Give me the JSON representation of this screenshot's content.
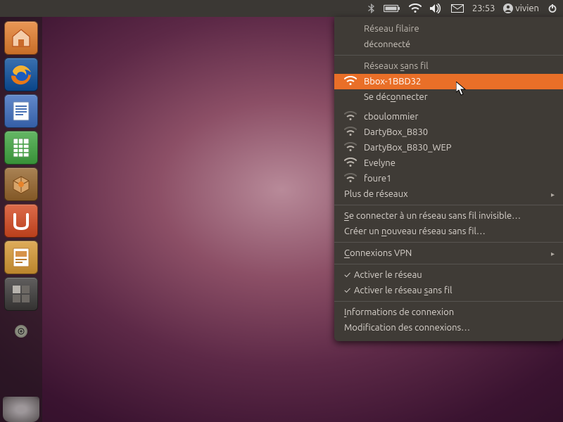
{
  "panel": {
    "time": "23:53",
    "user": "vivien"
  },
  "launcher": {
    "items": [
      {
        "id": "home",
        "name": "files-home"
      },
      {
        "id": "firefox",
        "name": "firefox"
      },
      {
        "id": "writer",
        "name": "libreoffice-writer"
      },
      {
        "id": "calc",
        "name": "libreoffice-calc"
      },
      {
        "id": "software",
        "name": "software-center"
      },
      {
        "id": "ubuntuone",
        "name": "ubuntu-one"
      },
      {
        "id": "impress",
        "name": "libreoffice-impress"
      },
      {
        "id": "workspace",
        "name": "workspace-switcher"
      }
    ]
  },
  "network_menu": {
    "wired_header": "Réseau filaire",
    "wired_status": "déconnecté",
    "wireless_header": "Réseaux sans fil",
    "selected_network": "Bbox-1BBD32",
    "disconnect": "Se déconnecter",
    "other_networks": [
      "cboulommier",
      "DartyBox_B830",
      "DartyBox_B830_WEP",
      "Evelyne",
      "foure1"
    ],
    "more_networks": "Plus de réseaux",
    "connect_hidden": "Se connecter à un réseau sans fil invisible…",
    "create_new": "Créer un nouveau réseau sans fil…",
    "vpn": "Connexions VPN",
    "enable_net": "Activer le réseau",
    "enable_wifi": "Activer le réseau sans fil",
    "conn_info": "Informations de connexion",
    "edit_conn": "Modification des connexions…"
  }
}
